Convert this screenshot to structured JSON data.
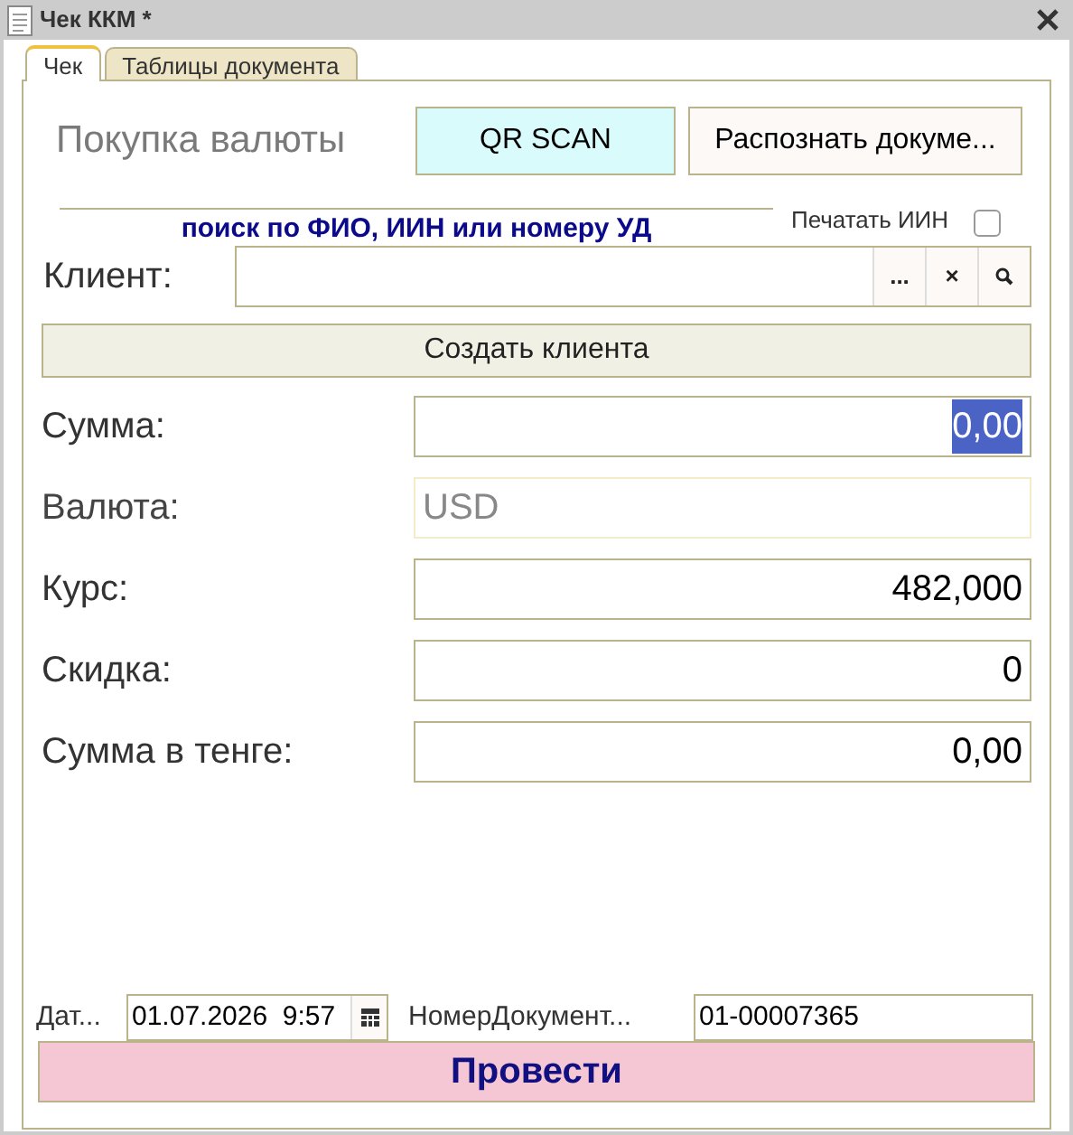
{
  "window": {
    "title": "Чек ККМ *"
  },
  "tabs": [
    {
      "label": "Чек",
      "selected": true
    },
    {
      "label": "Таблицы документа",
      "selected": false
    }
  ],
  "header": {
    "title": "Покупка валюты",
    "buttons": [
      {
        "label": "QR SCAN",
        "kind": "scan"
      },
      {
        "label": "Распознать докуме...",
        "kind": "plain"
      }
    ]
  },
  "search_hint": "поиск по ФИО, ИИН или номеру УД",
  "print_iin": {
    "label": "Печатать ИИН",
    "checked": false
  },
  "client": {
    "label": "Клиент:",
    "buttons": [
      "...",
      "×"
    ]
  },
  "create_client_button": "Создать клиента",
  "fields": [
    {
      "label": "Сумма:",
      "value": "0,00",
      "disabled": false,
      "value_selected": true
    },
    {
      "label": "Валюта:",
      "value": "USD",
      "disabled": true,
      "value_selected": false
    },
    {
      "label": "Курс:",
      "value": "482,000",
      "disabled": false,
      "value_selected": false
    },
    {
      "label": "Скидка:",
      "value": "0",
      "disabled": false,
      "value_selected": false
    },
    {
      "label": "Сумма в тенге:",
      "value": "0,00",
      "disabled": false,
      "value_selected": false
    }
  ],
  "footer": {
    "date_label": "Дат...",
    "date_value": "01.07.2026  9:57",
    "number_label": "НомерДокумент...",
    "number_value": "01-00007365"
  },
  "post_button": "Провести"
}
